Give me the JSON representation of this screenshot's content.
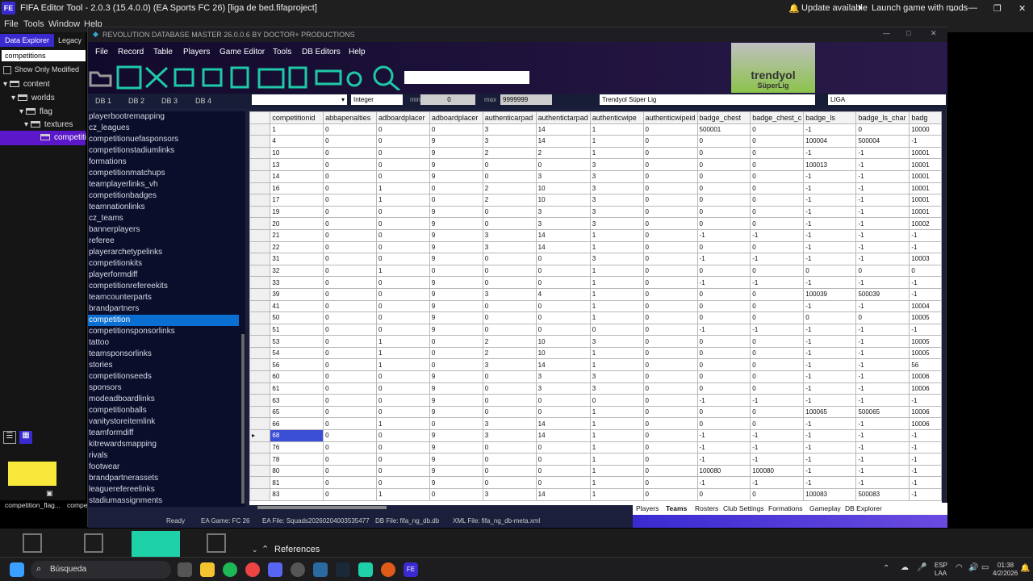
{
  "fet": {
    "logo": "FE",
    "title": "FIFA Editor Tool - 2.0.3 (15.4.0.0) (EA Sports FC 26) [liga de bed.fifaproject]",
    "update": "Update available",
    "launch": "Launch game with mods",
    "menu": [
      "File",
      "Tools",
      "Window",
      "Help"
    ],
    "tabs": [
      "Data Explorer",
      "Legacy Ex"
    ],
    "search": "competitions",
    "show_modified": "Show Only Modified",
    "tree": [
      "content",
      "worlds",
      "flag",
      "textures",
      "competiti"
    ],
    "thumbs": [
      "competition_flag...",
      "compe"
    ],
    "references": "References"
  },
  "app": {
    "title": "REVOLUTION DATABASE MASTER 26.0.0.6 BY DOCTOR+ PRODUCTIONS",
    "menu": [
      "File",
      "Record",
      "Table",
      "Players",
      "Game Editor",
      "Tools",
      "DB Editors",
      "Help"
    ],
    "db_tabs": [
      "DB 1",
      "DB 2",
      "DB 3",
      "DB 4"
    ],
    "filter": {
      "type": "Integer",
      "min_label": "min",
      "min": "0",
      "max_label": "max",
      "max": "9999999",
      "league": "Trendyol Süper Lig",
      "liga": "LIGA"
    },
    "brand": "trendyol",
    "brand_sub": "SüperLig",
    "tables": [
      "playerbootremapping",
      "cz_leagues",
      "competitionuefasponsors",
      "competitionstadiumlinks",
      "formations",
      "competitionmatchups",
      "teamplayerlinks_vh",
      "competitionbadges",
      "teamnationlinks",
      "cz_teams",
      "bannerplayers",
      "referee",
      "playerarchetypelinks",
      "competitionkits",
      "playerformdiff",
      "competitionrefereekits",
      "teamcounterparts",
      "brandpartners",
      "competition",
      "competitionsponsorlinks",
      "tattoo",
      "teamsponsorlinks",
      "stories",
      "competitionseeds",
      "sponsors",
      "modeadboardlinks",
      "competitionballs",
      "vanitystoreitemlink",
      "teamformdiff",
      "kitrewardsmapping",
      "rivals",
      "footwear",
      "brandpartnerassets",
      "leaguerefereelinks",
      "stadiumassignments"
    ],
    "columns": [
      "competitionid",
      "abbapenalties",
      "adboardplacer",
      "adboardplacer",
      "authenticarpad",
      "authentictarpad",
      "authenticwipe",
      "authenticwipeid",
      "badge_chest",
      "badge_chest_c",
      "badge_ls",
      "badge_ls_char",
      "badg"
    ],
    "rows": [
      [
        "1",
        "0",
        "0",
        "0",
        "3",
        "14",
        "1",
        "0",
        "500001",
        "0",
        "-1",
        "0",
        "10000"
      ],
      [
        "4",
        "0",
        "0",
        "9",
        "3",
        "14",
        "1",
        "0",
        "0",
        "0",
        "100004",
        "500004",
        "-1"
      ],
      [
        "10",
        "0",
        "0",
        "9",
        "2",
        "2",
        "1",
        "0",
        "0",
        "0",
        "-1",
        "-1",
        "10001"
      ],
      [
        "13",
        "0",
        "0",
        "9",
        "0",
        "0",
        "3",
        "0",
        "0",
        "0",
        "100013",
        "-1",
        "10001"
      ],
      [
        "14",
        "0",
        "0",
        "9",
        "0",
        "3",
        "3",
        "0",
        "0",
        "0",
        "-1",
        "-1",
        "10001"
      ],
      [
        "16",
        "0",
        "1",
        "0",
        "2",
        "10",
        "3",
        "0",
        "0",
        "0",
        "-1",
        "-1",
        "10001"
      ],
      [
        "17",
        "0",
        "1",
        "0",
        "2",
        "10",
        "3",
        "0",
        "0",
        "0",
        "-1",
        "-1",
        "10001"
      ],
      [
        "19",
        "0",
        "0",
        "9",
        "0",
        "3",
        "3",
        "0",
        "0",
        "0",
        "-1",
        "-1",
        "10001"
      ],
      [
        "20",
        "0",
        "0",
        "9",
        "0",
        "3",
        "3",
        "0",
        "0",
        "0",
        "-1",
        "-1",
        "10002"
      ],
      [
        "21",
        "0",
        "0",
        "9",
        "3",
        "14",
        "1",
        "0",
        "-1",
        "-1",
        "-1",
        "-1",
        "-1"
      ],
      [
        "22",
        "0",
        "0",
        "9",
        "3",
        "14",
        "1",
        "0",
        "0",
        "0",
        "-1",
        "-1",
        "-1"
      ],
      [
        "31",
        "0",
        "0",
        "9",
        "0",
        "0",
        "3",
        "0",
        "-1",
        "-1",
        "-1",
        "-1",
        "10003"
      ],
      [
        "32",
        "0",
        "1",
        "0",
        "0",
        "0",
        "1",
        "0",
        "0",
        "0",
        "0",
        "0",
        "0"
      ],
      [
        "33",
        "0",
        "0",
        "9",
        "0",
        "0",
        "1",
        "0",
        "-1",
        "-1",
        "-1",
        "-1",
        "-1"
      ],
      [
        "39",
        "0",
        "0",
        "9",
        "3",
        "4",
        "1",
        "0",
        "0",
        "0",
        "100039",
        "500039",
        "-1"
      ],
      [
        "41",
        "0",
        "0",
        "9",
        "0",
        "0",
        "1",
        "0",
        "0",
        "0",
        "-1",
        "-1",
        "10004"
      ],
      [
        "50",
        "0",
        "0",
        "9",
        "0",
        "0",
        "1",
        "0",
        "0",
        "0",
        "0",
        "0",
        "10005"
      ],
      [
        "51",
        "0",
        "0",
        "9",
        "0",
        "0",
        "0",
        "0",
        "-1",
        "-1",
        "-1",
        "-1",
        "-1"
      ],
      [
        "53",
        "0",
        "1",
        "0",
        "2",
        "10",
        "3",
        "0",
        "0",
        "0",
        "-1",
        "-1",
        "10005"
      ],
      [
        "54",
        "0",
        "1",
        "0",
        "2",
        "10",
        "1",
        "0",
        "0",
        "0",
        "-1",
        "-1",
        "10005"
      ],
      [
        "56",
        "0",
        "1",
        "0",
        "3",
        "14",
        "1",
        "0",
        "0",
        "0",
        "-1",
        "-1",
        "56"
      ],
      [
        "60",
        "0",
        "0",
        "9",
        "0",
        "3",
        "3",
        "0",
        "0",
        "0",
        "-1",
        "-1",
        "10006"
      ],
      [
        "61",
        "0",
        "0",
        "9",
        "0",
        "3",
        "3",
        "0",
        "0",
        "0",
        "-1",
        "-1",
        "10006"
      ],
      [
        "63",
        "0",
        "0",
        "9",
        "0",
        "0",
        "0",
        "0",
        "-1",
        "-1",
        "-1",
        "-1",
        "-1"
      ],
      [
        "65",
        "0",
        "0",
        "9",
        "0",
        "0",
        "1",
        "0",
        "0",
        "0",
        "100065",
        "500065",
        "10006"
      ],
      [
        "66",
        "0",
        "1",
        "0",
        "3",
        "14",
        "1",
        "0",
        "0",
        "0",
        "-1",
        "-1",
        "10006"
      ],
      [
        "68",
        "0",
        "0",
        "9",
        "3",
        "14",
        "1",
        "0",
        "-1",
        "-1",
        "-1",
        "-1",
        "-1"
      ],
      [
        "76",
        "0",
        "0",
        "9",
        "0",
        "0",
        "1",
        "0",
        "-1",
        "-1",
        "-1",
        "-1",
        "-1"
      ],
      [
        "78",
        "0",
        "0",
        "9",
        "0",
        "0",
        "1",
        "0",
        "-1",
        "-1",
        "-1",
        "-1",
        "-1"
      ],
      [
        "80",
        "0",
        "0",
        "9",
        "0",
        "0",
        "1",
        "0",
        "100080",
        "100080",
        "-1",
        "-1",
        "-1"
      ],
      [
        "81",
        "0",
        "0",
        "9",
        "0",
        "0",
        "1",
        "0",
        "-1",
        "-1",
        "-1",
        "-1",
        "-1"
      ],
      [
        "83",
        "0",
        "1",
        "0",
        "3",
        "14",
        "1",
        "0",
        "0",
        "0",
        "100083",
        "500083",
        "-1"
      ]
    ],
    "bottom_tabs": [
      "Players",
      "Teams",
      "Rosters",
      "Club Settings",
      "Formations",
      "Gameplay",
      "DB Explorer"
    ],
    "status": [
      "Ready",
      "EA Game: FC 26",
      "EA File: Squads20260204003535477",
      "DB File: fifa_ng_db.db",
      "XML File: fifa_ng_db-meta.xml"
    ]
  },
  "taskbar": {
    "search": "Búsqueda",
    "lang1": "ESP",
    "lang2": "LAA",
    "time": "01:38",
    "date": "4/2/2026"
  }
}
